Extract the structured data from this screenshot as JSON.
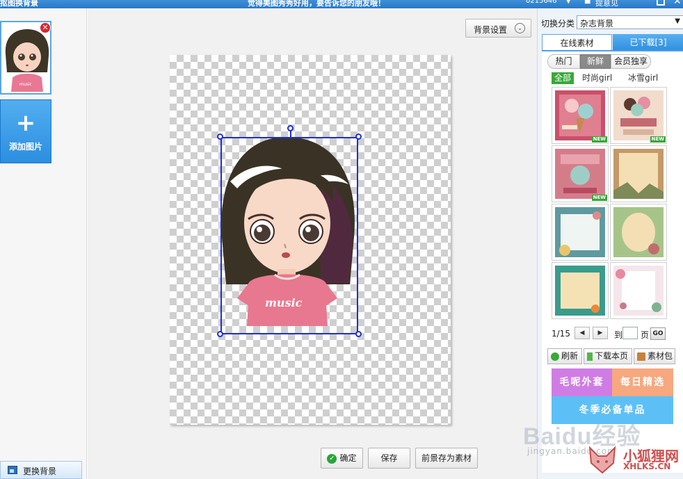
{
  "titlebar": {
    "left_title": "抠图换背景",
    "center_text": "觉得美图秀秀好用，要告诉您的朋友哦！",
    "user_id": "0215646",
    "feedback": "提意见",
    "close": "✕",
    "chevron": "▼"
  },
  "left": {
    "delete_symbol": "✕",
    "add_symbol": "+",
    "add_label": "添加图片",
    "change_bg_label": "更换背景"
  },
  "main": {
    "bg_settings_label": "背景设置",
    "bg_settings_arrow": "⌄",
    "ok_icon": "✓",
    "ok_label": "确定",
    "save_label": "保存",
    "save_fg_label": "前景存为素材"
  },
  "right": {
    "category_label": "切换分类",
    "category_value": "杂志背景",
    "category_arrow": "▼",
    "tab_online": "在线素材",
    "tab_downloaded": "已下载[3]",
    "pills": [
      "热门",
      "新鲜",
      "会员独享"
    ],
    "filters": [
      "全部",
      "时尚girl",
      "冰雪girl"
    ],
    "new_badge": "NEW",
    "pager": {
      "count": "1/15",
      "prev": "◀",
      "next": "▶",
      "to": "到",
      "unit": "页",
      "go": "GO"
    },
    "actions": [
      "刷新",
      "下载本页",
      "素材包"
    ],
    "promos": [
      "毛呢外套",
      "每日精选",
      "冬季必备单品"
    ]
  },
  "watermark": {
    "brand": "Baidu经验",
    "url": "jingyan.baidu.com",
    "site_name": "小狐狸网",
    "site_url": "XHLKS.CN"
  },
  "colors": {
    "accent_blue": "#2f8fe0",
    "selection": "#1f2fd0",
    "green": "#38a83a"
  }
}
